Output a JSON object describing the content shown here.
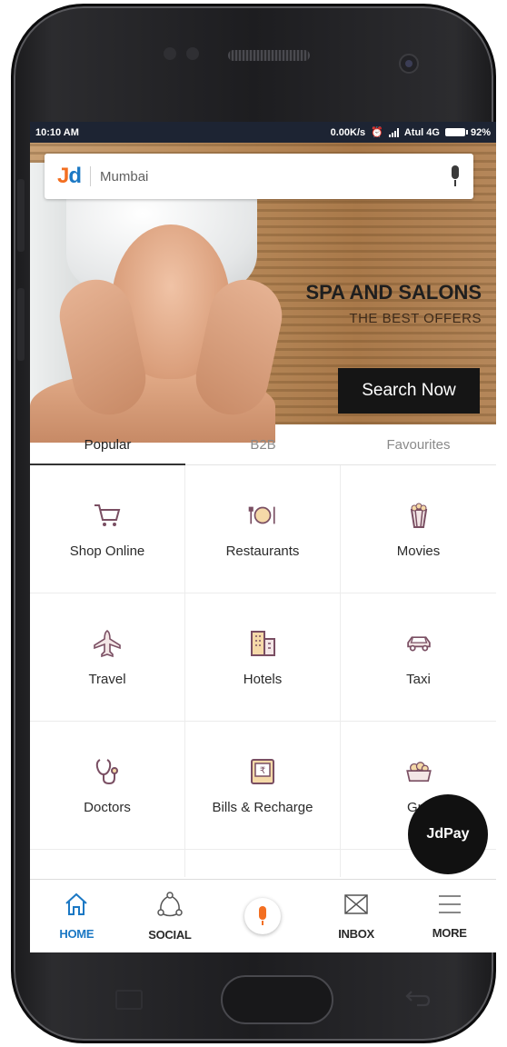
{
  "status_bar": {
    "time": "10:10 AM",
    "speed": "0.00K/s",
    "carrier": "Atul 4G",
    "battery": "92%"
  },
  "search": {
    "logo_j": "J",
    "logo_d": "d",
    "location": "Mumbai"
  },
  "promo": {
    "title": "SPA AND SALONS",
    "subtitle": "THE BEST OFFERS",
    "button": "Search Now"
  },
  "tabs": [
    {
      "label": "Popular",
      "active": true
    },
    {
      "label": "B2B",
      "active": false
    },
    {
      "label": "Favourites",
      "active": false
    }
  ],
  "categories": [
    {
      "label": "Shop Online",
      "icon": "cart-icon"
    },
    {
      "label": "Restaurants",
      "icon": "plate-icon"
    },
    {
      "label": "Movies",
      "icon": "popcorn-icon"
    },
    {
      "label": "Travel",
      "icon": "plane-icon"
    },
    {
      "label": "Hotels",
      "icon": "building-icon"
    },
    {
      "label": "Taxi",
      "icon": "car-icon"
    },
    {
      "label": "Doctors",
      "icon": "stethoscope-icon"
    },
    {
      "label": "Bills & Recharge",
      "icon": "bill-icon"
    },
    {
      "label": "Gro",
      "icon": "basket-icon"
    }
  ],
  "fab": {
    "label": "JdPay"
  },
  "bottom_nav": [
    {
      "label": "HOME",
      "icon": "home-icon",
      "active": true
    },
    {
      "label": "SOCIAL",
      "icon": "social-icon",
      "active": false
    },
    {
      "label": "",
      "icon": "mic-icon",
      "active": false
    },
    {
      "label": "INBOX",
      "icon": "inbox-icon",
      "active": false
    },
    {
      "label": "MORE",
      "icon": "menu-icon",
      "active": false
    }
  ],
  "colors": {
    "brand_orange": "#f36f21",
    "brand_blue": "#1b78c4",
    "status_bar": "#1d2433"
  }
}
